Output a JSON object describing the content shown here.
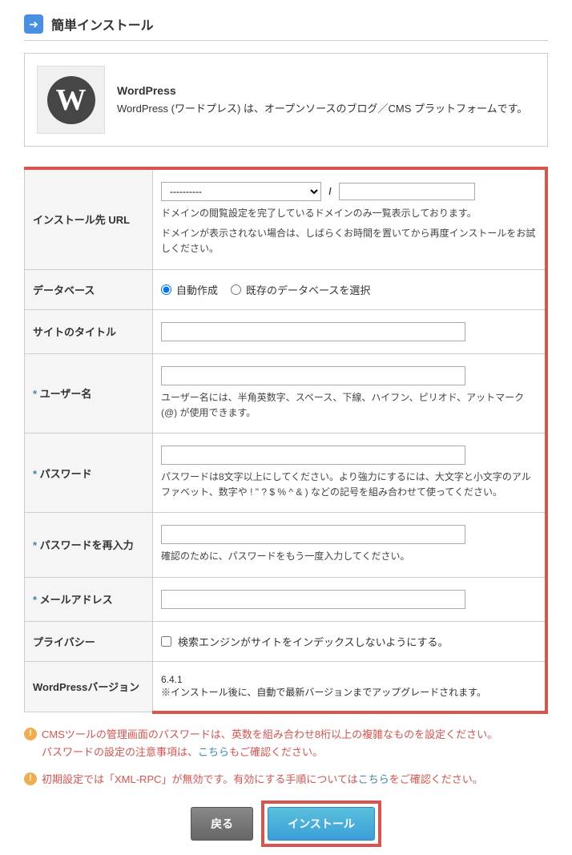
{
  "header": {
    "title": "簡単インストール"
  },
  "app": {
    "name": "WordPress",
    "description": "WordPress (ワードプレス) は、オープンソースのブログ／CMS プラットフォームです。"
  },
  "form": {
    "url": {
      "label": "インストール先 URL",
      "domain_placeholder": "----------",
      "slash": "/",
      "help1": "ドメインの閲覧設定を完了しているドメインのみ一覧表示しております。",
      "help2": "ドメインが表示されない場合は、しばらくお時間を置いてから再度インストールをお試しください。"
    },
    "database": {
      "label": "データベース",
      "option_auto": "自動作成",
      "option_existing": "既存のデータベースを選択"
    },
    "site_title": {
      "label": "サイトのタイトル"
    },
    "username": {
      "label": "ユーザー名",
      "help": "ユーザー名には、半角英数字、スペース、下線、ハイフン、ピリオド、アットマーク (@) が使用できます。"
    },
    "password": {
      "label": "パスワード",
      "help": "パスワードは8文字以上にしてください。より強力にするには、大文字と小文字のアルファベット、数字や ! \" ? $ % ^ & ) などの記号を組み合わせて使ってください。"
    },
    "password_confirm": {
      "label": "パスワードを再入力",
      "help": "確認のために、パスワードをもう一度入力してください。"
    },
    "email": {
      "label": "メールアドレス"
    },
    "privacy": {
      "label": "プライバシー",
      "checkbox_label": "検索エンジンがサイトをインデックスしないようにする。"
    },
    "version": {
      "label": "WordPressバージョン",
      "value": "6.4.1",
      "note": "※インストール後に、自動で最新バージョンまでアップグレードされます。"
    }
  },
  "notices": {
    "notice1_line1": "CMSツールの管理画面のパスワードは、英数を組み合わせ8桁以上の複雑なものを設定ください。",
    "notice1_line2_prefix": "パスワードの設定の注意事項は、",
    "notice1_link": "こちら",
    "notice1_line2_suffix": "もご確認ください。",
    "notice2_prefix": "初期設定では「XML-RPC」が無効です。有効にする手順については",
    "notice2_link": "こちら",
    "notice2_suffix": "をご確認ください。"
  },
  "buttons": {
    "back": "戻る",
    "install": "インストール"
  }
}
